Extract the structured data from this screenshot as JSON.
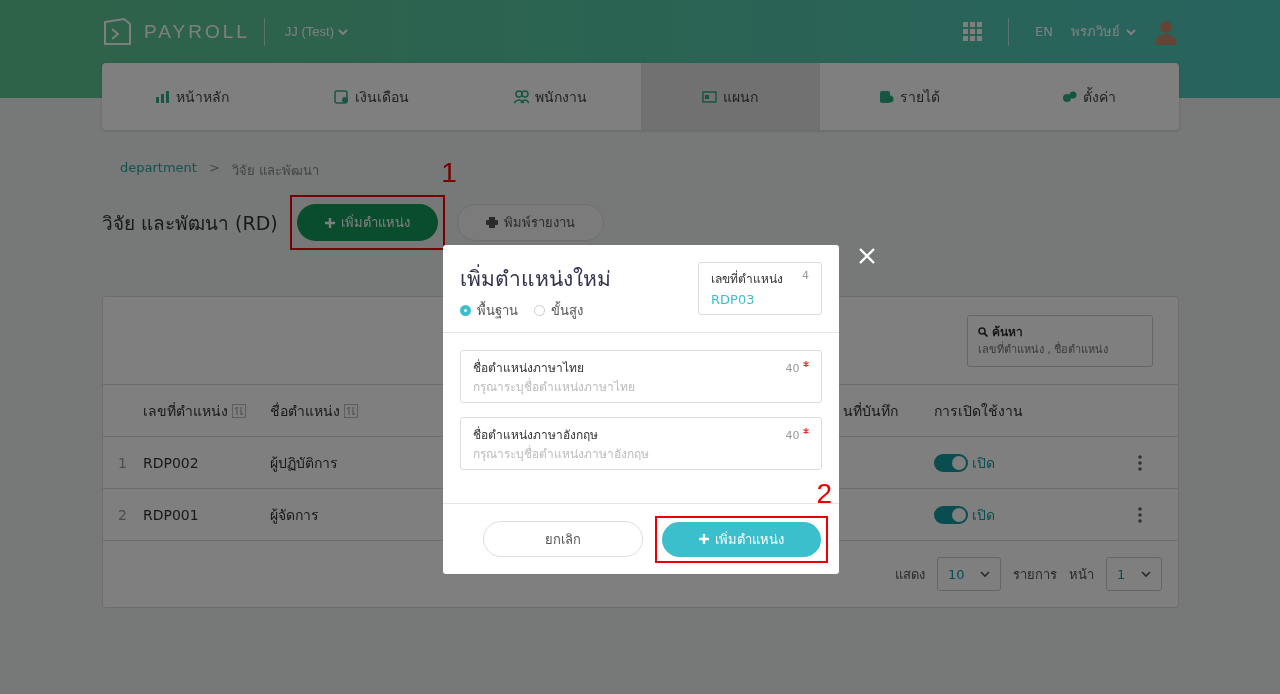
{
  "header": {
    "logo": "PAYROLL",
    "company": "JJ (Test)",
    "language": "EN",
    "user": "พรภวิษย์"
  },
  "nav_tabs": [
    {
      "label": "หน้าหลัก",
      "selected": false
    },
    {
      "label": "เงินเดือน",
      "selected": false
    },
    {
      "label": "พนักงาน",
      "selected": false
    },
    {
      "label": "แผนก",
      "selected": true
    },
    {
      "label": "รายได้",
      "selected": false
    },
    {
      "label": "ตั้งค่า",
      "selected": false
    }
  ],
  "breadcrumb": {
    "link": "department",
    "separator": ">",
    "current": "วิจัย และพัฒนา"
  },
  "page_title": "วิจัย และพัฒนา (RD)",
  "actions": [
    {
      "label": "เพิ่มตำแหน่ง",
      "kind": "primary",
      "annotation": "1"
    },
    {
      "label": "พิมพ์รายงาน",
      "kind": "print"
    }
  ],
  "search": {
    "label": "ค้นหา",
    "placeholder": "เลขที่ตำแหน่ง , ชื่อตำแหน่ง"
  },
  "table": {
    "columns": [
      {
        "label": "เลขที่ตำแหน่ง",
        "sortable": true
      },
      {
        "label": "ชื่อตำแหน่ง",
        "sortable": true
      },
      {
        "label": "นที่บันทึก",
        "sortable": false
      },
      {
        "label": "การเปิดใช้งาน",
        "sortable": false
      }
    ],
    "rows": [
      {
        "index": "1",
        "code": "RDP002",
        "name": "ผู้ปฏิบัติการ",
        "enabled": true,
        "status": "เปิด"
      },
      {
        "index": "2",
        "code": "RDP001",
        "name": "ผู้จัดการ",
        "enabled": true,
        "status": "เปิด"
      }
    ]
  },
  "pagination": {
    "show_label": "แสดง",
    "page_size": "10",
    "items_label": "รายการ",
    "page_label": "หน้า",
    "page": "1"
  },
  "modal": {
    "title": "เพิ่มตำแหน่งใหม่",
    "levels": [
      {
        "label": "พื้นฐาน",
        "selected": true
      },
      {
        "label": "ขั้นสูง",
        "selected": false
      }
    ],
    "code_field": {
      "label": "เลขที่ตำแหน่ง",
      "counter": "4",
      "value": "RDP03"
    },
    "fields": [
      {
        "label": "ชื่อตำแหน่งภาษาไทย",
        "counter": "40",
        "required": true,
        "placeholder": "กรุณาระบุชื่อตำแหน่งภาษาไทย"
      },
      {
        "label": "ชื่อตำแหน่งภาษาอังกฤษ",
        "counter": "40",
        "required": true,
        "placeholder": "กรุณาระบุชื่อตำแหน่งภาษาอังกฤษ"
      }
    ],
    "cancel": "ยกเลิก",
    "submit": "เพิ่มตำแหน่ง",
    "submit_annotation": "2"
  }
}
